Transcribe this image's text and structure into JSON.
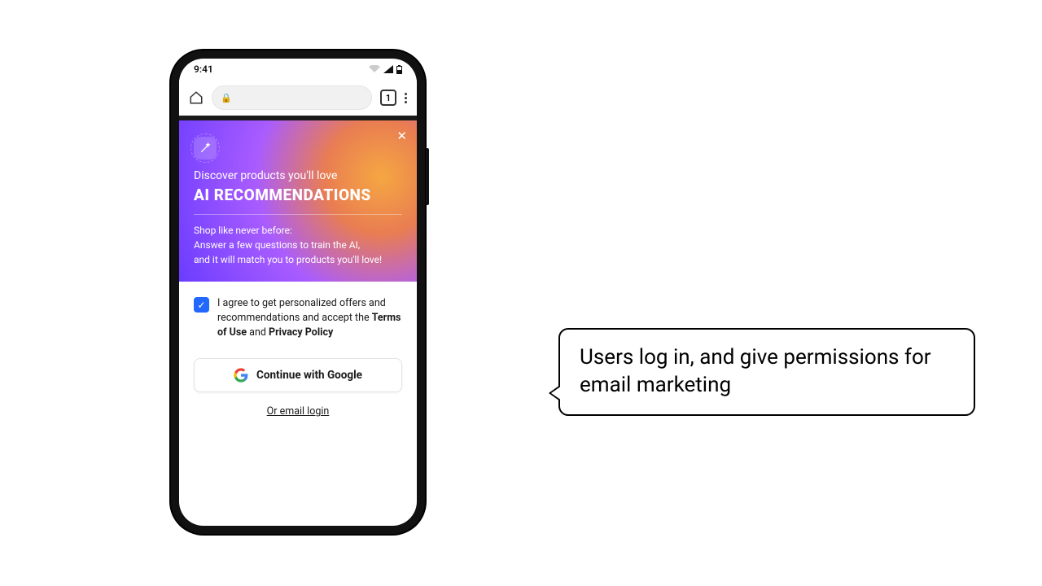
{
  "status": {
    "time": "9:41",
    "tabs_count": "1"
  },
  "hero": {
    "subtitle": "Discover products you'll love",
    "title": "AI RECOMMENDATIONS",
    "body_line1": "Shop like never before:",
    "body_line2": "Answer a few questions to train the AI,",
    "body_line3": "and it will match you to products you'll love!"
  },
  "consent": {
    "prefix": "I agree to get personalized offers and recommendations and accept the ",
    "terms": "Terms of Use",
    "and": " and ",
    "privacy": "Privacy Policy"
  },
  "buttons": {
    "google": "Continue with Google",
    "email_login": "Or email login"
  },
  "callout": {
    "text": "Users log in, and give permissions for email marketing"
  }
}
